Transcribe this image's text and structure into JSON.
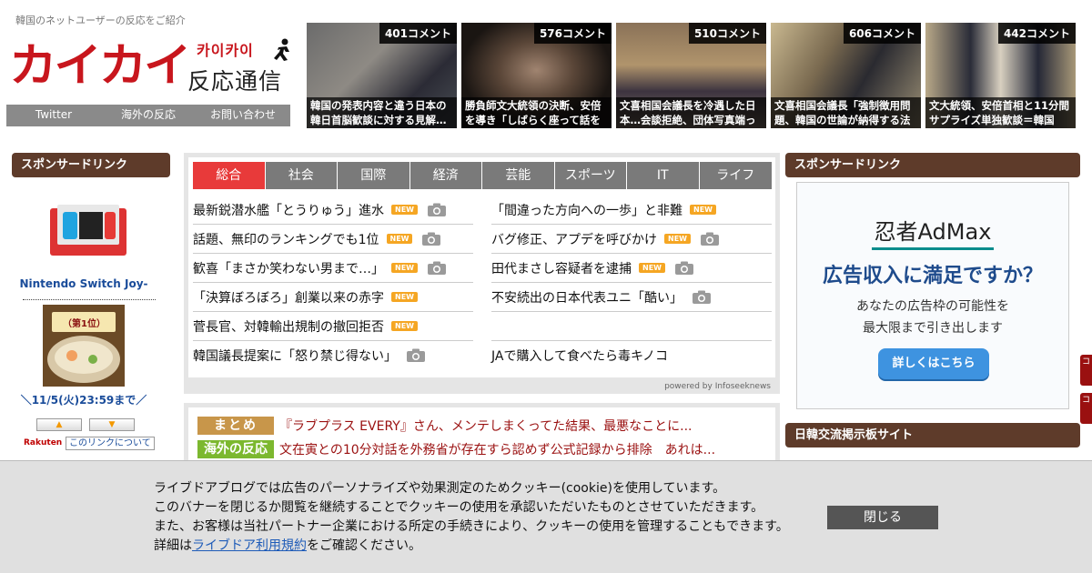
{
  "header": {
    "tagline": "韓国のネットユーザーの反応をご紹介",
    "logo_main": "カイカイ",
    "logo_kana": "카이카이",
    "logo_sub": "反応通信"
  },
  "nav": [
    {
      "label": "Twitter"
    },
    {
      "label": "海外の反応"
    },
    {
      "label": "お問い合わせ"
    }
  ],
  "thumbnails": [
    {
      "count": "401コメント",
      "caption": "韓国の発表内容と違う日本の韓日首脳歓談に対する見解…"
    },
    {
      "count": "576コメント",
      "caption": "勝負師文大統領の決断、安倍を導き「しばらく座って話を"
    },
    {
      "count": "510コメント",
      "caption": "文喜相国会議長を冷遇した日本…会談拒絶、団体写真端っ"
    },
    {
      "count": "606コメント",
      "caption": "文喜相国会議長「強制徴用問題、韓国の世論が納得する法"
    },
    {
      "count": "442コメント",
      "caption": "文大統領、安倍首相と11分間サプライズ単独歓談＝韓国"
    }
  ],
  "left_sidebar": {
    "heading": "スポンサードリンク",
    "product1_name": "Nintendo Switch Joy-",
    "product2_badge": "（第1位）",
    "product2_text": "＼11/5(火)23:59まで／",
    "rakuten": "Rakuten",
    "link_info": "このリンクについて"
  },
  "news": {
    "tabs": [
      {
        "label": "総合",
        "active": true
      },
      {
        "label": "社会",
        "active": false
      },
      {
        "label": "国際",
        "active": false
      },
      {
        "label": "経済",
        "active": false
      },
      {
        "label": "芸能",
        "active": false
      },
      {
        "label": "スポーツ",
        "active": false
      },
      {
        "label": "IT",
        "active": false
      },
      {
        "label": "ライフ",
        "active": false
      }
    ],
    "new_label": "NEW",
    "left": [
      {
        "title": "最新鋭潜水艦「とうりゅう」進水",
        "new": true,
        "photo": true
      },
      {
        "title": "話題、無印のランキングでも1位",
        "new": true,
        "photo": true
      },
      {
        "title": "歓喜「まさか笑わない男まで…」",
        "new": true,
        "photo": true
      },
      {
        "title": "「決算ぼろぼろ」創業以来の赤字",
        "new": true,
        "photo": false
      },
      {
        "title": "菅長官、対韓輸出規制の撤回拒否",
        "new": true,
        "photo": false
      },
      {
        "title": "韓国議長提案に「怒り禁じ得ない」",
        "new": false,
        "photo": true
      }
    ],
    "right": [
      {
        "title": "「間違った方向への一歩」と非難",
        "new": true,
        "photo": false
      },
      {
        "title": "バグ修正、アプデを呼びかけ",
        "new": true,
        "photo": true
      },
      {
        "title": "田代まさし容疑者を逮捕",
        "new": true,
        "photo": true
      },
      {
        "title": "不安続出の日本代表ユニ「酷い」",
        "new": false,
        "photo": true
      },
      {
        "title": "",
        "new": false,
        "photo": false
      },
      {
        "title": "JAで購入して食べたら毒キノコ",
        "new": false,
        "photo": false
      }
    ],
    "powered_by": "powered by Infoseeknews"
  },
  "matome": [
    {
      "tag": "まとめ",
      "color": "#c8964a",
      "text": "『ラブプラス EVERY』さん、メンテしまくってた結果、最悪なことに..."
    },
    {
      "tag": "海外の反応",
      "color": "#7cb82f",
      "text": "文在寅との10分対話を外務省が存在すら認めず公式記録から排除　あれは..."
    }
  ],
  "right_sidebar": {
    "heading1": "スポンサードリンク",
    "ad_logo": "忍者AdMax",
    "ad_headline": "広告収入に満足ですか？",
    "ad_line1": "あなたの広告枠の可能性を",
    "ad_line2": "最大限まで引き出します",
    "ad_button": "詳しくはこちら",
    "heading2": "日韓交流掲示板サイト",
    "edge1": "コ",
    "edge2": "コ"
  },
  "cookie": {
    "line1": "ライブドアブログでは広告のパーソナライズや効果測定のためクッキー(cookie)を使用しています。",
    "line2": "このバナーを閉じるか閲覧を継続することでクッキーの使用を承認いただいたものとさせていただきます。",
    "line3": "また、お客様は当社パートナー企業における所定の手続きにより、クッキーの使用を管理することもできます。",
    "line4_pre": "詳細は",
    "line4_link": "ライブドア利用規約",
    "line4_post": "をご確認ください。",
    "close": "閉じる"
  },
  "colors": {
    "brand_red": "#c8161d",
    "sidebar_head": "#5e3b2a",
    "tab_active": "#e83a3a",
    "tab_inactive": "#7a7a7a",
    "new_badge": "#f5a623"
  }
}
